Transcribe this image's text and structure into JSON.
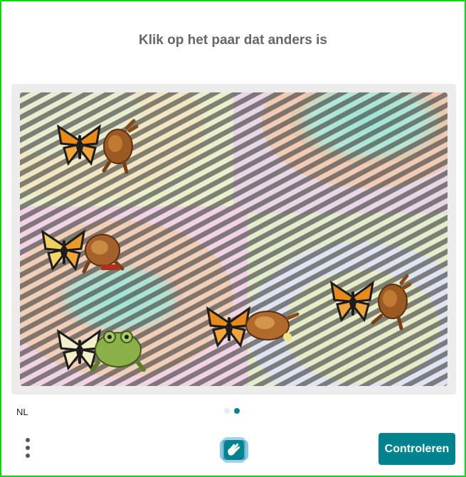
{
  "challenge": {
    "prompt": "Klik op het paar dat anders is"
  },
  "pairs": [
    {
      "id": "pair-1",
      "items": [
        "butterfly-icon",
        "roast-chicken-icon"
      ]
    },
    {
      "id": "pair-2",
      "items": [
        "butterfly-icon",
        "roast-chicken-icon"
      ]
    },
    {
      "id": "pair-3",
      "items": [
        "butterfly-icon",
        "frog-icon"
      ]
    },
    {
      "id": "pair-4",
      "items": [
        "butterfly-icon",
        "roast-chicken-icon"
      ]
    },
    {
      "id": "pair-5",
      "items": [
        "butterfly-icon",
        "roast-chicken-icon"
      ]
    }
  ],
  "footer": {
    "language": "NL",
    "submit_label": "Controleren",
    "pages": {
      "current": 2,
      "total": 2
    },
    "logo_icon": "hcaptcha-hand-icon",
    "menu_icon": "more-vertical-icon"
  },
  "colors": {
    "accent": "#00838f",
    "title_text": "#666666",
    "frame_border": "#14d414",
    "dot_inactive": "#e8eef0"
  }
}
